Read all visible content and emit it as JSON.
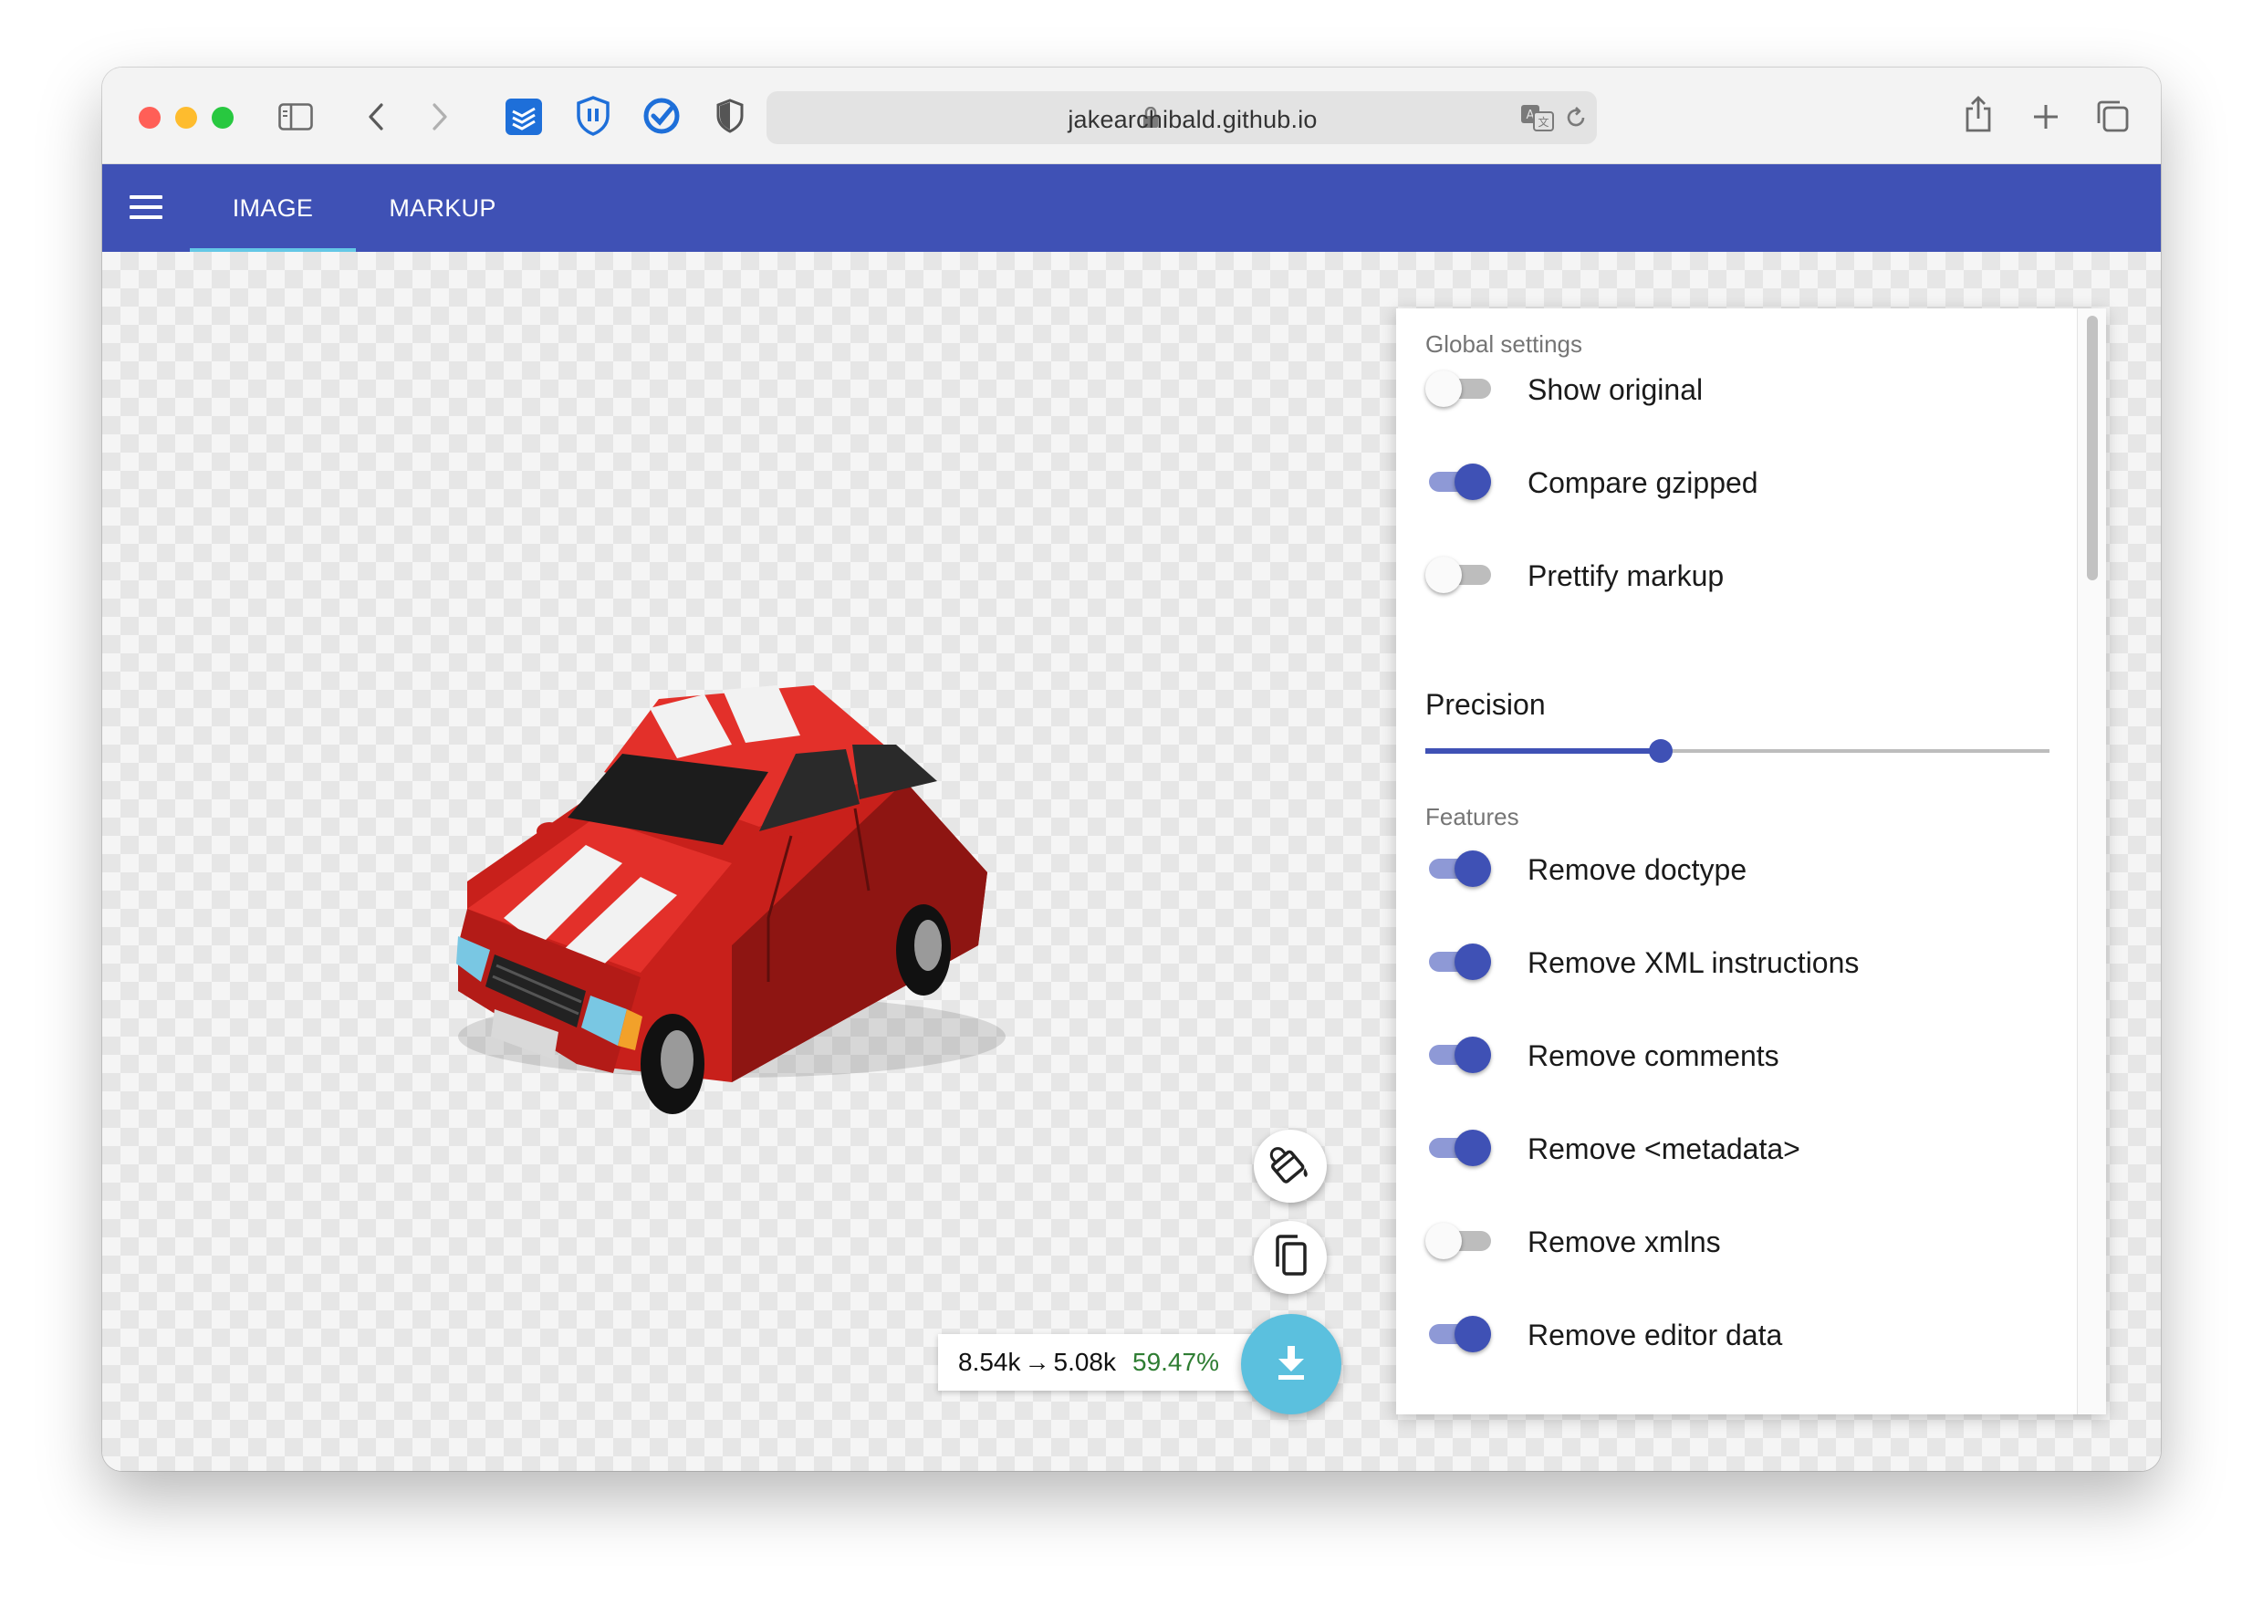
{
  "browser": {
    "url": "jakearchibald.github.io",
    "traffic_lights": {
      "close": "#ff5f57",
      "minimize": "#febc2e",
      "zoom": "#28c840"
    }
  },
  "appbar": {
    "color": "#3f51b5",
    "tabs": [
      {
        "label": "IMAGE",
        "active": true
      },
      {
        "label": "MARKUP",
        "active": false
      }
    ]
  },
  "settings": {
    "global_title": "Global settings",
    "global": [
      {
        "label": "Show original",
        "on": false
      },
      {
        "label": "Compare gzipped",
        "on": true
      },
      {
        "label": "Prettify markup",
        "on": false
      }
    ],
    "precision_label": "Precision",
    "precision_fraction": 0.377,
    "features_title": "Features",
    "features": [
      {
        "label": "Remove doctype",
        "on": true
      },
      {
        "label": "Remove XML instructions",
        "on": true
      },
      {
        "label": "Remove comments",
        "on": true
      },
      {
        "label": "Remove <metadata>",
        "on": true
      },
      {
        "label": "Remove xmlns",
        "on": false
      },
      {
        "label": "Remove editor data",
        "on": true
      }
    ]
  },
  "results": {
    "original": "8.54k",
    "arrow": "→",
    "optimized": "5.08k",
    "percent": "59.47%",
    "percent_color": "#2e7d32"
  },
  "actions": {
    "background_icon": "paint-bucket-icon",
    "copy_icon": "copy-icon",
    "download_icon": "download-icon",
    "download_color": "#5bc0de"
  }
}
